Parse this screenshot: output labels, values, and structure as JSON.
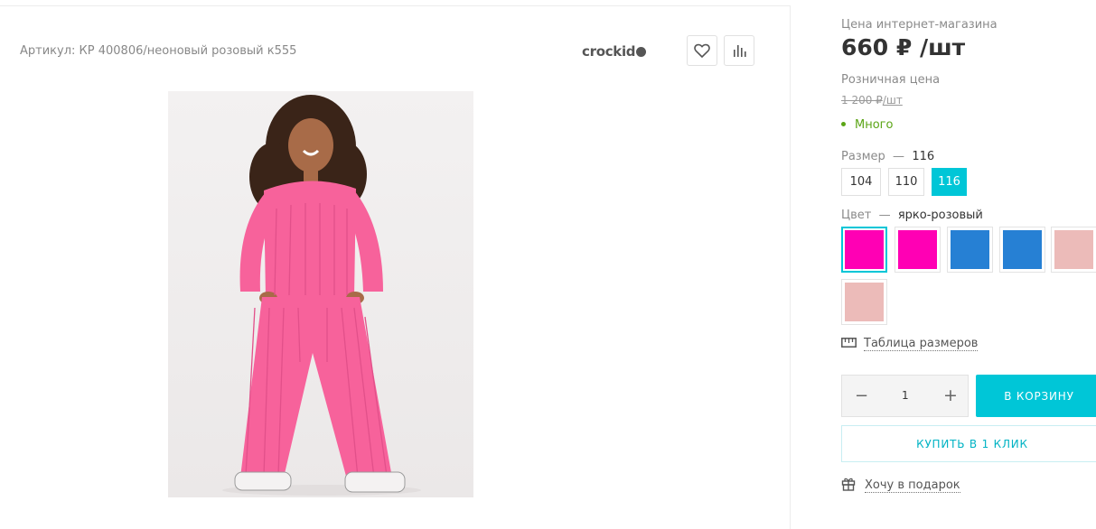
{
  "product": {
    "article": "Артикул: КР 400806/неоновый розовый к555",
    "brand": "crockid"
  },
  "price": {
    "online_label": "Цена интернет-магазина",
    "online_value": "660 ₽ /шт",
    "retail_label": "Розничная цена",
    "retail_old": "1 200 ₽",
    "retail_unit": "/шт",
    "stock": "Много"
  },
  "size": {
    "label": "Размер",
    "dash": "—",
    "selected": "116",
    "options": [
      "104",
      "110",
      "116"
    ]
  },
  "color": {
    "label": "Цвет",
    "dash": "—",
    "selected": "ярко-розовый",
    "swatches": [
      "#ff00b4",
      "#ff00b4",
      "#2680d4",
      "#2680d4",
      "#ecbbb9",
      "#ecbbb9"
    ]
  },
  "links": {
    "size_table": "Таблица размеров",
    "gift": "Хочу в подарок"
  },
  "cart": {
    "quantity": "1",
    "add_label": "В КОРЗИНУ",
    "one_click_label": "КУПИТЬ В 1 КЛИК"
  },
  "colors": {
    "accent": "#00c6d7",
    "in_stock": "#5ba516",
    "product_pink": "#f7629b"
  }
}
